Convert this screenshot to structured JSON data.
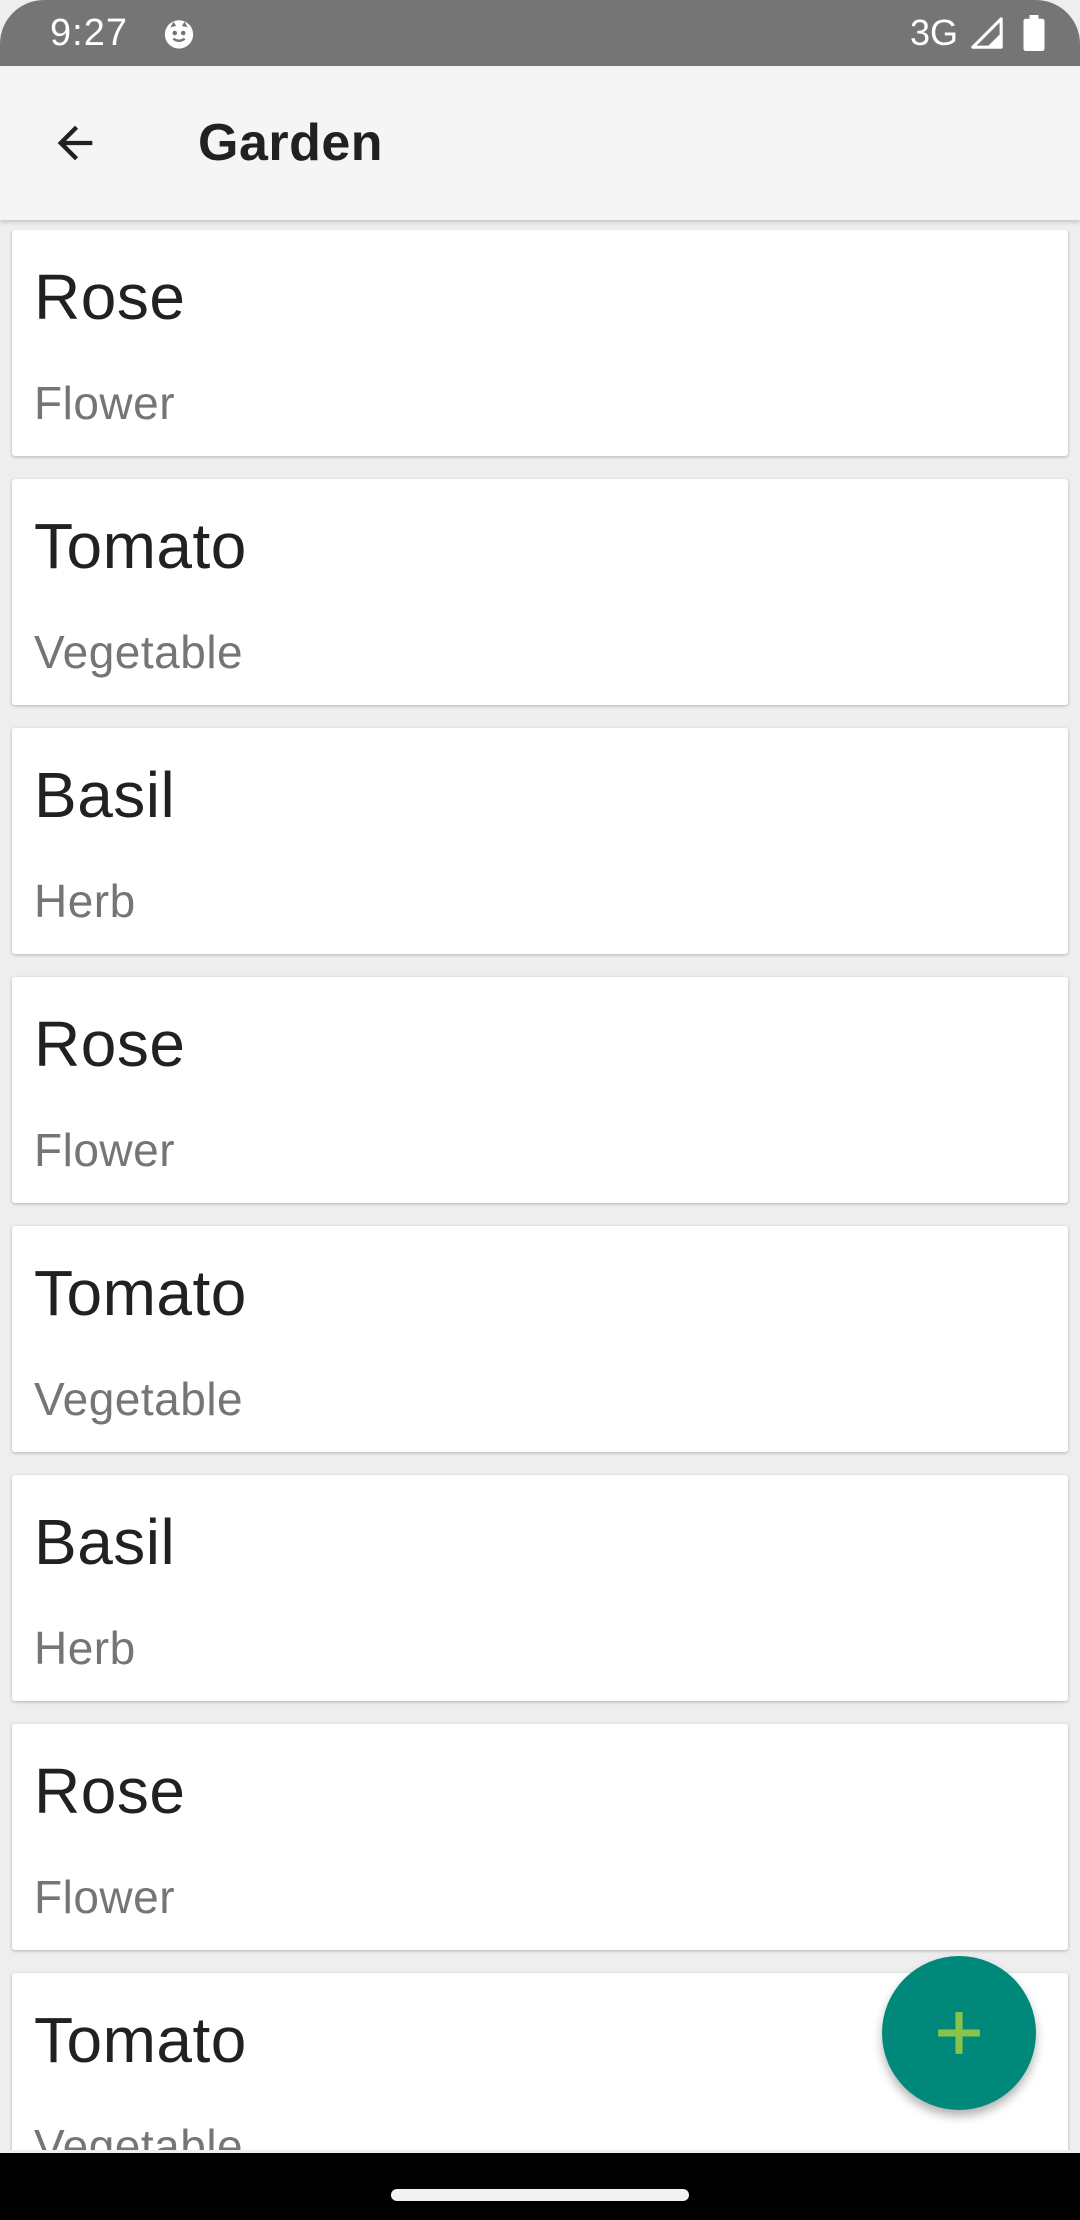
{
  "status_bar": {
    "time": "9:27",
    "network": "3G",
    "icons": [
      "cat-notification-icon",
      "signal-icon",
      "battery-icon"
    ]
  },
  "app_bar": {
    "title": "Garden",
    "back_icon": "arrow-back-icon"
  },
  "plants": [
    {
      "name": "Rose",
      "type": "Flower"
    },
    {
      "name": "Tomato",
      "type": "Vegetable"
    },
    {
      "name": "Basil",
      "type": "Herb"
    },
    {
      "name": "Rose",
      "type": "Flower"
    },
    {
      "name": "Tomato",
      "type": "Vegetable"
    },
    {
      "name": "Basil",
      "type": "Herb"
    },
    {
      "name": "Rose",
      "type": "Flower"
    },
    {
      "name": "Tomato",
      "type": "Vegetable"
    }
  ],
  "fab": {
    "icon": "plus-icon"
  },
  "colors": {
    "status_bar": "#757575",
    "app_bar": "#f5f5f5",
    "fab": "#00897b",
    "fab_icon": "#8bc34a",
    "background": "#eeeeee"
  }
}
